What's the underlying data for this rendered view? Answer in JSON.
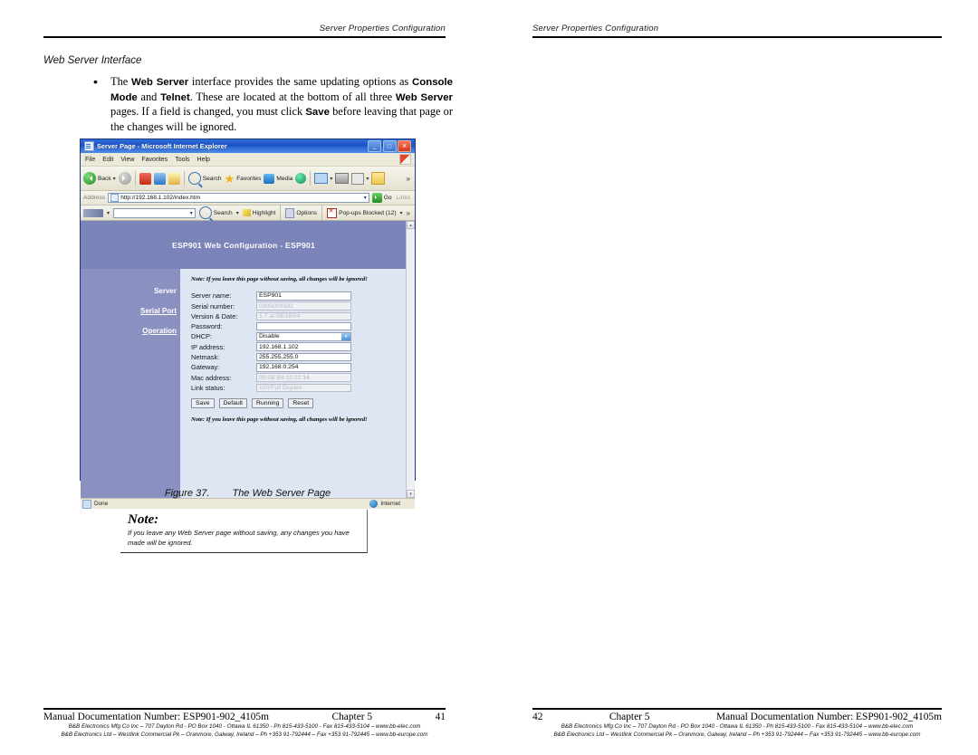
{
  "left_page": {
    "header": "Server Properties Configuration",
    "section_title": "Web Server Interface",
    "bullet": {
      "marker": "•",
      "parts": [
        {
          "t": "The ",
          "b": false
        },
        {
          "t": "Web Server",
          "b": true
        },
        {
          "t": " interface provides the same updating options as ",
          "b": false
        },
        {
          "t": "Console Mode",
          "b": true
        },
        {
          "t": " and ",
          "b": false
        },
        {
          "t": "Telnet",
          "b": true
        },
        {
          "t": ". These are located at the bottom of all three ",
          "b": false
        },
        {
          "t": "Web Server",
          "b": true
        },
        {
          "t": " pages. If a field is changed, you must click ",
          "b": false
        },
        {
          "t": "Save",
          "b": true
        },
        {
          "t": " before leaving that page or the changes will be ignored.",
          "b": false
        }
      ]
    },
    "figure_caption": {
      "number": "Figure 37.",
      "title": "The Web Server Page"
    },
    "note": {
      "title": "Note:",
      "body": "If you leave any Web Server page without saving, any changes you have made will be ignored."
    },
    "footer": {
      "doc": "Manual Documentation Number: ESP901-902_4105m",
      "chapter": "Chapter 5",
      "page": "41",
      "addr1": "B&B Electronics Mfg Co Inc – 707 Dayton Rd - PO Box 1040 - Ottawa IL 61350 - Ph 815-433-5100 - Fax 815-433-5104 – www.bb-elec.com",
      "addr2": "B&B Electronics Ltd – Westlink Commercial Pk – Oranmore, Galway, Ireland – Ph +353 91-792444 – Fax +353 91-792445 – www.bb-europe.com"
    }
  },
  "right_page": {
    "header": "Server Properties Configuration",
    "footer": {
      "doc": "Manual Documentation Number: ESP901-902_4105m",
      "chapter": "Chapter 5",
      "page": "42",
      "addr1": "B&B Electronics Mfg Co Inc – 707 Dayton Rd - PO Box 1040 - Ottawa IL 61350 - Ph 815-433-5100 - Fax 815-433-5104 – www.bb-elec.com",
      "addr2": "B&B Electronics Ltd – Westlink Commercial Pk – Oranmore, Galway, Ireland – Ph +353 91-792444 – Fax +353 91-792445 – www.bb-europe.com"
    }
  },
  "browser": {
    "title": "Server Page - Microsoft Internet Explorer",
    "window_buttons": {
      "minimize": "_",
      "maximize": "□",
      "close": "✕"
    },
    "menu": [
      "File",
      "Edit",
      "View",
      "Favorites",
      "Tools",
      "Help"
    ],
    "toolbar": {
      "back": "Back",
      "forward": "",
      "stop": "",
      "refresh": "",
      "home": "",
      "search": "Search",
      "favorites": "Favorites",
      "media": "Media",
      "history": "",
      "mail": "",
      "print": "",
      "edit": "",
      "discuss": "",
      "more": "»",
      "caret": "▾"
    },
    "address": {
      "label": "Address",
      "url": "http://192.168.1.102/index.htm",
      "go": "Go",
      "links": "Links",
      "dropdown": "▾"
    },
    "searchbar": {
      "query": "",
      "search": "Search",
      "highlight": "Highlight",
      "options": "Options",
      "popups": "Pop-ups Blocked (12)",
      "caret": "▾",
      "more": "»"
    },
    "status": {
      "text": "Done",
      "zone": "Internet"
    },
    "scroll": {
      "up": "▴",
      "down": "▾"
    }
  },
  "webpage": {
    "banner": "ESP901 Web Configuration - ESP901",
    "sidebar": [
      {
        "label": "Server",
        "underlined": false
      },
      {
        "label": "Serial Port",
        "underlined": true
      },
      {
        "label": "Operation",
        "underlined": true
      }
    ],
    "note_top": "Note: If you leave this page without saving, all changes will be ignored!",
    "note_bottom": "Note: If you leave this page without saving, all changes will be ignored!",
    "fields": [
      {
        "label": "Server name:",
        "value": "ESP901",
        "readonly": false,
        "type": "text"
      },
      {
        "label": "Serial number:",
        "value": "0305000532",
        "readonly": true,
        "type": "text"
      },
      {
        "label": "Version & Date:",
        "value": "1.7 at 08/18/04",
        "readonly": true,
        "type": "text"
      },
      {
        "label": "Password:",
        "value": "",
        "readonly": false,
        "type": "text"
      },
      {
        "label": "DHCP:",
        "value": "Disable",
        "readonly": false,
        "type": "select"
      },
      {
        "label": "IP address:",
        "value": "192.168.1.102",
        "readonly": false,
        "type": "text"
      },
      {
        "label": "Netmask:",
        "value": "255.255.255.0",
        "readonly": false,
        "type": "text"
      },
      {
        "label": "Gateway:",
        "value": "192.168.0.254",
        "readonly": false,
        "type": "text"
      },
      {
        "label": "Mac address:",
        "value": "00:0B:B4:11:02:14",
        "readonly": true,
        "type": "text"
      },
      {
        "label": "Link status:",
        "value": "100/Full Duplex",
        "readonly": true,
        "type": "text"
      }
    ],
    "buttons": [
      "Save",
      "Default",
      "Running",
      "Reset"
    ]
  },
  "colors": {
    "banner_purple": "#7b84b8",
    "sidebar_purple": "#8a90bf",
    "panel_blue": "#dde6f2",
    "titlebar_blue": "#1d4fc0"
  }
}
